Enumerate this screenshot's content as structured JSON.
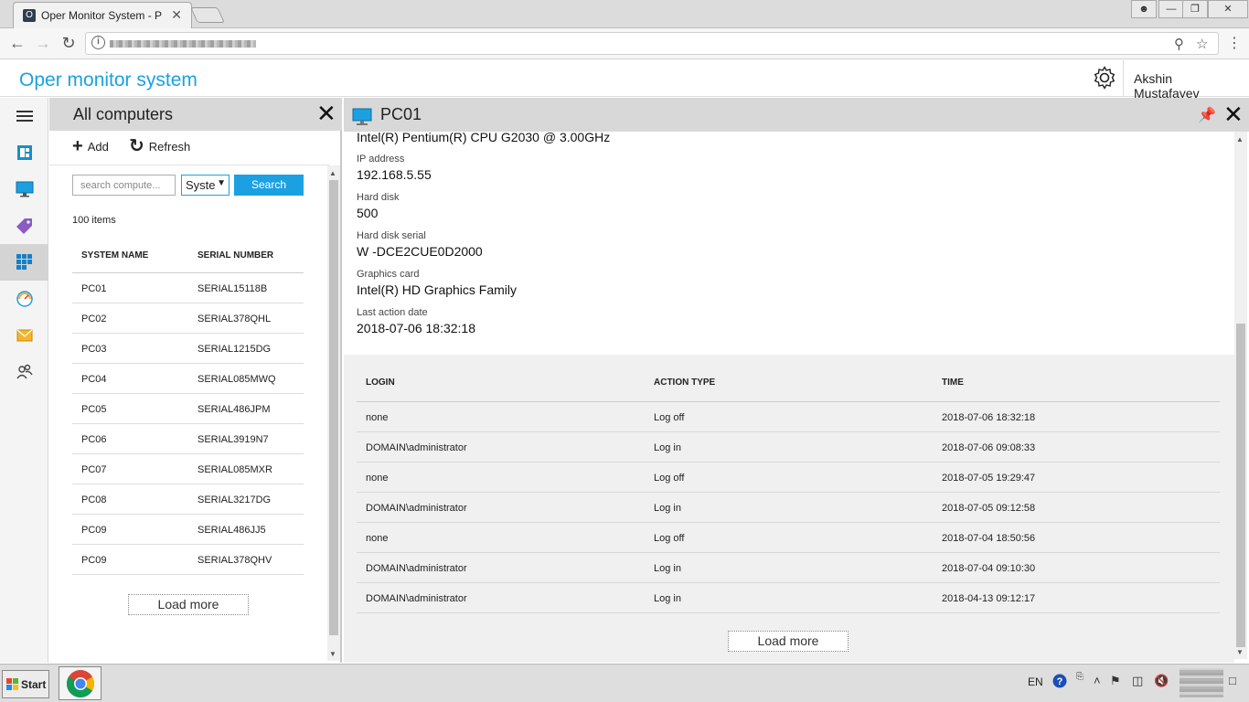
{
  "browser": {
    "tab_title": "Oper Monitor System - Port",
    "tab_favicon": "O"
  },
  "app": {
    "title": "Oper monitor system",
    "user": "Akshin Mustafayev"
  },
  "nav": {
    "items": [
      {
        "icon": "hamburger-icon"
      },
      {
        "icon": "dashboard-icon"
      },
      {
        "icon": "monitor-icon"
      },
      {
        "icon": "tag-icon"
      },
      {
        "icon": "windows-grid-icon"
      },
      {
        "icon": "speedometer-icon"
      },
      {
        "icon": "mail-icon"
      },
      {
        "icon": "users-icon"
      }
    ]
  },
  "computers": {
    "title": "All computers",
    "add_label": "Add",
    "refresh_label": "Refresh",
    "search_placeholder": "search compute...",
    "filter_value": "Syste",
    "search_label": "Search",
    "count_label": "100 items",
    "columns": [
      "SYSTEM NAME",
      "SERIAL NUMBER"
    ],
    "rows": [
      {
        "name": "PC01",
        "serial": "SERIAL15118B"
      },
      {
        "name": "PC02",
        "serial": "SERIAL378QHL"
      },
      {
        "name": "PC03",
        "serial": "SERIAL1215DG"
      },
      {
        "name": "PC04",
        "serial": "SERIAL085MWQ"
      },
      {
        "name": "PC05",
        "serial": "SERIAL486JPM"
      },
      {
        "name": "PC06",
        "serial": "SERIAL3919N7"
      },
      {
        "name": "PC07",
        "serial": "SERIAL085MXR"
      },
      {
        "name": "PC08",
        "serial": "SERIAL3217DG"
      },
      {
        "name": "PC09",
        "serial": "SERIAL486JJ5"
      },
      {
        "name": "PC09",
        "serial": "SERIAL378QHV"
      }
    ],
    "load_more": "Load more"
  },
  "detail": {
    "title": "PC01",
    "cpu": "Intel(R) Pentium(R) CPU G2030 @ 3.00GHz",
    "fields": [
      {
        "label": "IP address",
        "value": "192.168.5.55"
      },
      {
        "label": "Hard disk",
        "value": "500"
      },
      {
        "label": "Hard disk serial",
        "value": "W -DCE2CUE0D2000"
      },
      {
        "label": "Graphics card",
        "value": "Intel(R) HD Graphics Family"
      },
      {
        "label": "Last action date",
        "value": "2018-07-06 18:32:18"
      }
    ],
    "log_columns": [
      "LOGIN",
      "ACTION TYPE",
      "TIME"
    ],
    "log_rows": [
      {
        "login": "none",
        "action": "Log off",
        "time": "2018-07-06 18:32:18"
      },
      {
        "login": "DOMAIN\\administrator",
        "action": "Log in",
        "time": "2018-07-06 09:08:33"
      },
      {
        "login": "none",
        "action": "Log off",
        "time": "2018-07-05 19:29:47"
      },
      {
        "login": "DOMAIN\\administrator",
        "action": "Log in",
        "time": "2018-07-05 09:12:58"
      },
      {
        "login": "none",
        "action": "Log off",
        "time": "2018-07-04 18:50:56"
      },
      {
        "login": "DOMAIN\\administrator",
        "action": "Log in",
        "time": "2018-07-04 09:10:30"
      },
      {
        "login": "DOMAIN\\administrator",
        "action": "Log in",
        "time": "2018-04-13 09:12:17"
      }
    ],
    "load_more": "Load more"
  },
  "taskbar": {
    "start_label": "Start",
    "language": "EN"
  },
  "colors": {
    "accent": "#1ba1e2",
    "header_gray": "#d8d8d8"
  }
}
